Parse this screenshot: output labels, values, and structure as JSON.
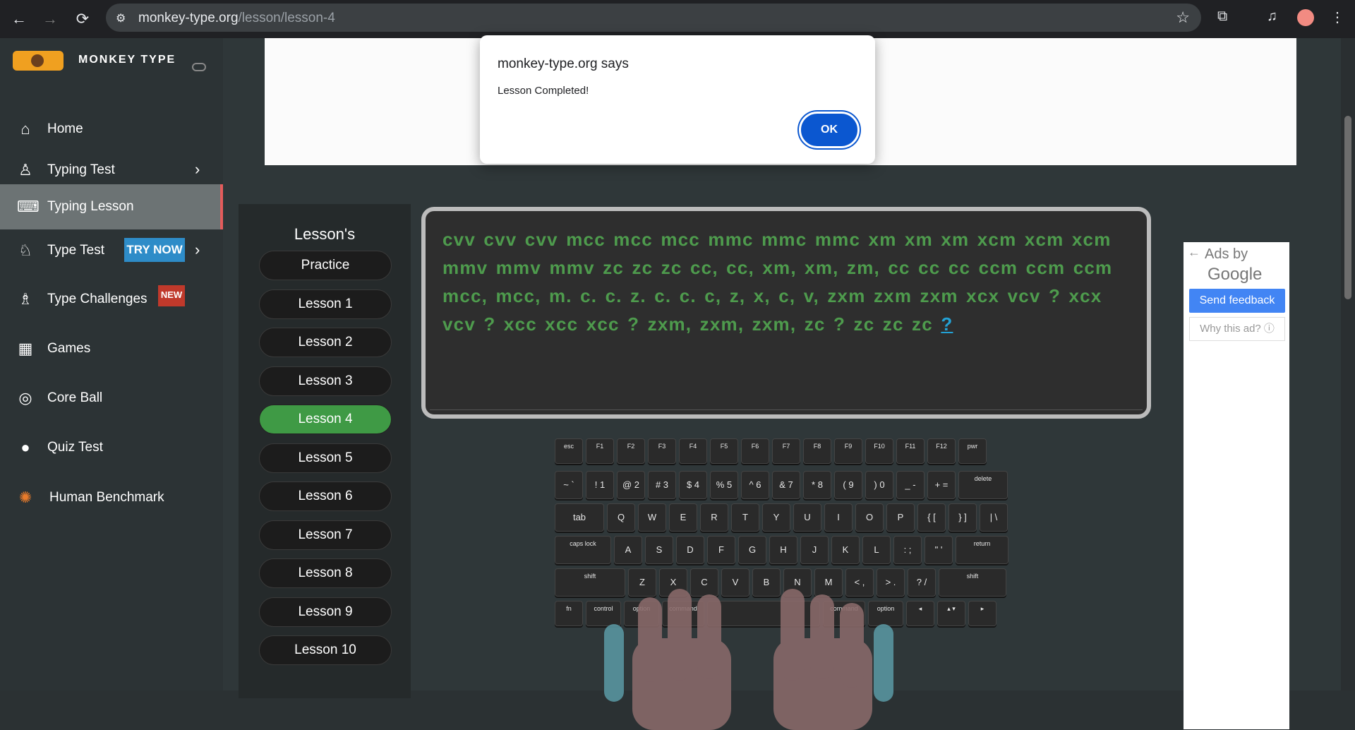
{
  "browser": {
    "url_domain": "monkey-type.org",
    "url_path": "/lesson/lesson-4",
    "back_icon": "←",
    "forward_icon": "→",
    "reload_icon": "⟳"
  },
  "sidebar": {
    "brand": "MONKEY TYPE",
    "items": [
      {
        "label": "Home",
        "icon": "⌂"
      },
      {
        "label": "Typing Test",
        "icon": "♙"
      },
      {
        "label": "Typing Lesson",
        "icon": "⌨"
      },
      {
        "label": "Type Test",
        "icon": "♘",
        "badge": "TRY NOW"
      },
      {
        "label": "Type Challenges",
        "icon": "♗",
        "badge": "NEW"
      },
      {
        "label": "Games",
        "icon": "▦"
      },
      {
        "label": "Core Ball",
        "icon": "◎"
      },
      {
        "label": "Quiz Test",
        "icon": "●"
      },
      {
        "label": "Human Benchmark",
        "icon": "✺"
      }
    ]
  },
  "lessons": {
    "title": "Lesson's",
    "items": [
      "Practice",
      "Lesson 1",
      "Lesson 2",
      "Lesson 3",
      "Lesson 4",
      "Lesson 5",
      "Lesson 6",
      "Lesson 7",
      "Lesson 8",
      "Lesson 9",
      "Lesson 10"
    ],
    "active": "Lesson 4"
  },
  "typing": {
    "text": "cvv cvv cvv mcc mcc mcc mmc mmc mmc xm xm xm xcm xcm xcm mmv mmv mmv zc zc zc cc, cc, xm, xm, zm, cc cc cc ccm ccm ccm mcc, mcc, m. c. c. z. c. c. c, z, x, c, v, zxm zxm zxm xcx vcv ? xcx vcv ? xcc xcc xcc ? zxm, zxm, zxm, zc ? zc zc zc",
    "cursor_char": "?"
  },
  "keyboard": {
    "rows": [
      [
        "esc",
        "F1",
        "F2",
        "F3",
        "F4",
        "F5",
        "F6",
        "F7",
        "F8",
        "F9",
        "F10",
        "F11",
        "F12",
        "pwr"
      ],
      [
        "~ `",
        "! 1",
        "@ 2",
        "# 3",
        "$ 4",
        "% 5",
        "^ 6",
        "& 7",
        "* 8",
        "( 9",
        ") 0",
        "_ -",
        "+ =",
        "delete"
      ],
      [
        "tab",
        "Q",
        "W",
        "E",
        "R",
        "T",
        "Y",
        "U",
        "I",
        "O",
        "P",
        "{ [",
        "} ]",
        "| \\"
      ],
      [
        "caps lock",
        "A",
        "S",
        "D",
        "F",
        "G",
        "H",
        "J",
        "K",
        "L",
        ": ;",
        "\" '",
        "return"
      ],
      [
        "shift",
        "Z",
        "X",
        "C",
        "V",
        "B",
        "N",
        "M",
        "< ,",
        "> .",
        "? /",
        "shift"
      ],
      [
        "fn",
        "control",
        "option",
        "command",
        "",
        "command",
        "option",
        "◂",
        "▴ ▾",
        "▸"
      ]
    ]
  },
  "ad": {
    "ads_by": "Ads by",
    "google": "Google",
    "send_feedback": "Send feedback",
    "why": "Why this ad? ⓘ"
  },
  "dialog": {
    "title": "monkey-type.org says",
    "message": "Lesson Completed!",
    "ok": "OK"
  }
}
